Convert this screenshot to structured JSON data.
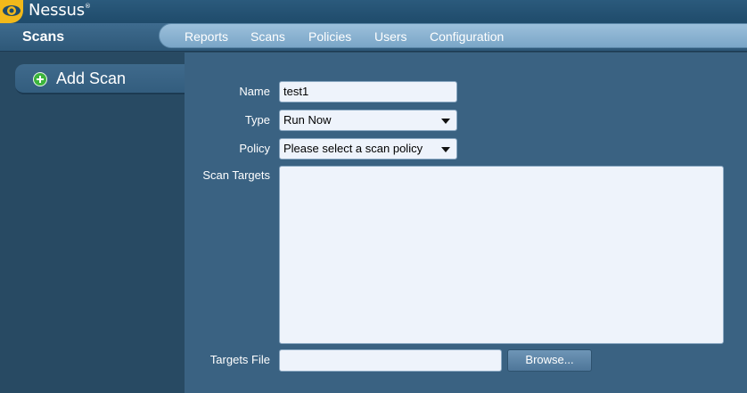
{
  "app": {
    "name": "Nessus",
    "trademark": "®"
  },
  "header": {
    "section_title": "Scans"
  },
  "nav": {
    "items": [
      {
        "label": "Reports"
      },
      {
        "label": "Scans"
      },
      {
        "label": "Policies"
      },
      {
        "label": "Users"
      },
      {
        "label": "Configuration"
      }
    ]
  },
  "sidebar": {
    "add_scan_label": "Add Scan"
  },
  "form": {
    "name_label": "Name",
    "name_value": "test1",
    "type_label": "Type",
    "type_value": "Run Now",
    "policy_label": "Policy",
    "policy_value": "Please select a scan policy",
    "scan_targets_label": "Scan Targets",
    "scan_targets_value": "",
    "targets_file_label": "Targets File",
    "targets_file_value": "",
    "browse_label": "Browse..."
  },
  "colors": {
    "accent": "#f2b91a",
    "nav_pill": "#8bb3d2",
    "panel": "#3a6282",
    "sidebar": "#284a63",
    "add_icon": "#3cb43c"
  },
  "icons": {
    "logo": "eye-icon",
    "add": "plus-circle-icon",
    "dropdown": "caret-down-icon"
  }
}
